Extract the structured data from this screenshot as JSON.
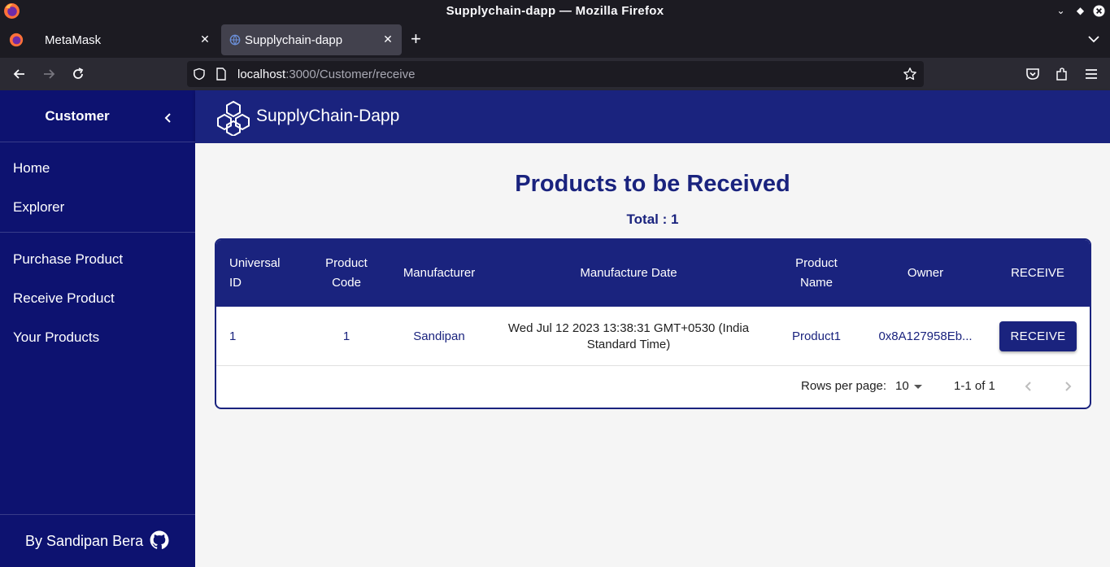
{
  "browser": {
    "window_title": "Supplychain-dapp — Mozilla Firefox",
    "tabs": [
      {
        "label": "MetaMask"
      },
      {
        "label": "Supplychain-dapp"
      }
    ],
    "url_host": "localhost",
    "url_rest": ":3000/Customer/receive"
  },
  "sidebar": {
    "title": "Customer",
    "items": [
      {
        "label": "Home"
      },
      {
        "label": "Explorer"
      },
      {
        "label": "Purchase Product"
      },
      {
        "label": "Receive Product"
      },
      {
        "label": "Your Products"
      }
    ],
    "footer": "By Sandipan Bera"
  },
  "app": {
    "name": "SupplyChain-Dapp"
  },
  "page": {
    "title": "Products to be Received",
    "total": "Total : 1"
  },
  "table": {
    "headers": {
      "universal_id_1": "Universal",
      "universal_id_2": "ID",
      "product_code_1": "Product",
      "product_code_2": "Code",
      "manufacturer": "Manufacturer",
      "manufacture_date": "Manufacture Date",
      "product_name_1": "Product",
      "product_name_2": "Name",
      "owner": "Owner",
      "receive": "RECEIVE"
    },
    "rows": [
      {
        "universal_id": "1",
        "product_code": "1",
        "manufacturer": "Sandipan",
        "date_line1": "Wed Jul 12 2023 13:38:31 GMT+0530 (India",
        "date_line2": "Standard Time)",
        "product_name": "Product1",
        "owner": "0x8A127958Eb...",
        "action": "RECEIVE"
      }
    ],
    "pagination": {
      "rows_per_page_label": "Rows per page:",
      "rows_per_page": "10",
      "range": "1-1 of 1"
    }
  },
  "colors": {
    "sidebar_bg": "#0d1270",
    "primary": "#1a237e",
    "browser_dark": "#1c1b22"
  }
}
